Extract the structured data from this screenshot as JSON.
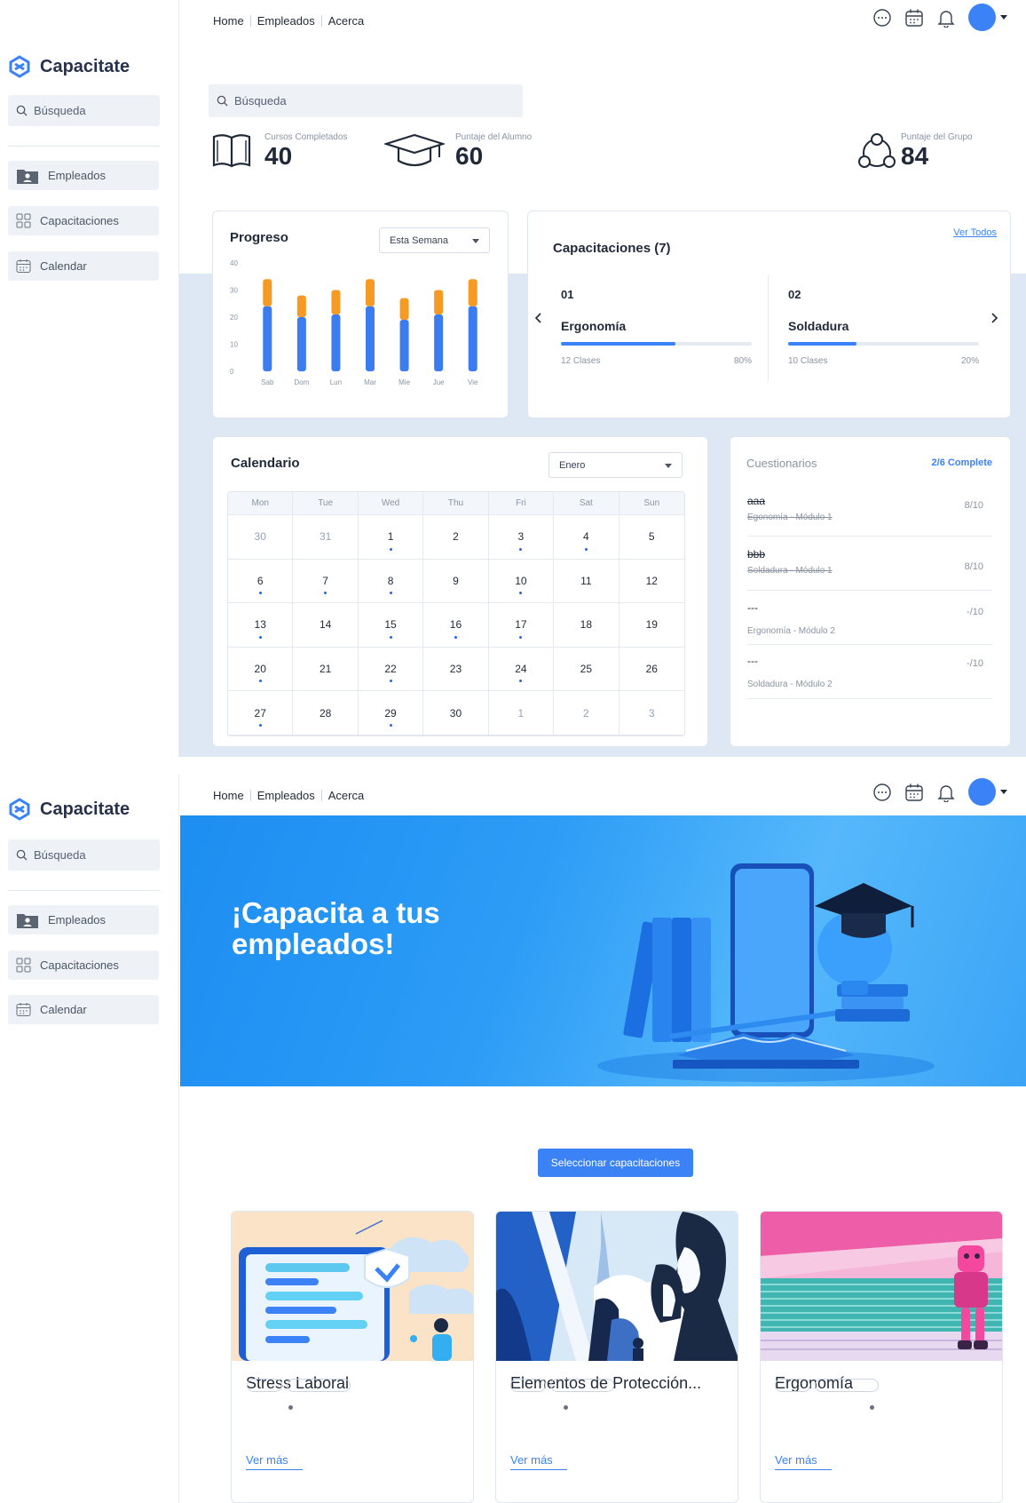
{
  "app": {
    "name": "Capacitate"
  },
  "topnav": {
    "items": [
      "Home",
      "Empleados",
      "Acerca"
    ]
  },
  "sidebar": {
    "search_placeholder": "Búsqueda",
    "items": [
      {
        "label": "Empleados",
        "icon": "folder-user-icon"
      },
      {
        "label": "Capacitaciones",
        "icon": "grid-icon"
      },
      {
        "label": "Calendar",
        "icon": "calendar-icon"
      }
    ]
  },
  "dashboard": {
    "search_placeholder": "Búsqueda",
    "stats": [
      {
        "label": "Cursos Completados",
        "value": "40",
        "icon": "book-icon"
      },
      {
        "label": "Puntaje del Alumno",
        "value": "60",
        "icon": "graduation-cap-icon"
      },
      {
        "label": "Puntaje del Grupo",
        "value": "84",
        "icon": "group-icon"
      }
    ],
    "progress": {
      "title": "Progreso",
      "select": "Esta Semana"
    },
    "trainings": {
      "title": "Capacitaciones (7)",
      "view_all": "Ver Todos",
      "items": [
        {
          "num": "01",
          "name": "Ergonomía",
          "classes": "12 Clases",
          "percent": "80%",
          "progress": 0.6
        },
        {
          "num": "02",
          "name": "Soldadura",
          "classes": "10 Clases",
          "percent": "20%",
          "progress": 0.36
        }
      ]
    },
    "calendar": {
      "title": "Calendario",
      "select": "Enero",
      "weekdays": [
        "Mon",
        "Tue",
        "Wed",
        "Thu",
        "Fri",
        "Sat",
        "Sun"
      ],
      "weeks": [
        [
          {
            "d": "30",
            "m": true
          },
          {
            "d": "31",
            "m": true
          },
          {
            "d": "1",
            "dot": true
          },
          {
            "d": "2"
          },
          {
            "d": "3",
            "dot": true
          },
          {
            "d": "4",
            "dot": true
          },
          {
            "d": "5"
          }
        ],
        [
          {
            "d": "6",
            "dot": true
          },
          {
            "d": "7",
            "dot": true
          },
          {
            "d": "8",
            "dot": true
          },
          {
            "d": "9"
          },
          {
            "d": "10",
            "dot": true
          },
          {
            "d": "11"
          },
          {
            "d": "12"
          }
        ],
        [
          {
            "d": "13",
            "dot": true
          },
          {
            "d": "14"
          },
          {
            "d": "15",
            "dot": true
          },
          {
            "d": "16",
            "dot": true
          },
          {
            "d": "17",
            "dot": true
          },
          {
            "d": "18"
          },
          {
            "d": "19"
          }
        ],
        [
          {
            "d": "20",
            "dot": true
          },
          {
            "d": "21"
          },
          {
            "d": "22",
            "dot": true
          },
          {
            "d": "23"
          },
          {
            "d": "24",
            "dot": true
          },
          {
            "d": "25"
          },
          {
            "d": "26"
          }
        ],
        [
          {
            "d": "27",
            "dot": true
          },
          {
            "d": "28"
          },
          {
            "d": "29",
            "dot": true
          },
          {
            "d": "30"
          },
          {
            "d": "1",
            "m": true
          },
          {
            "d": "2",
            "m": true
          },
          {
            "d": "3",
            "m": true
          }
        ]
      ]
    },
    "quizzes": {
      "title": "Cuestionarios",
      "status": "2/6 Complete",
      "items": [
        {
          "title": "aaa",
          "subtitle": "Egonomía - Módulo 1",
          "score": "8/10",
          "done": true
        },
        {
          "title": "bbb",
          "subtitle": "Soldadura - Módulo 1",
          "score": "8/10",
          "done": true
        },
        {
          "title": "---",
          "subtitle": "Ergonomía - Módulo 2",
          "score": "-/10",
          "done": false
        },
        {
          "title": "---",
          "subtitle": "Soldadura - Módulo 2",
          "score": "-/10",
          "done": false
        }
      ]
    }
  },
  "chart_data": {
    "type": "bar",
    "title": "Progreso",
    "categories": [
      "Sab",
      "Dom",
      "Lun",
      "Mar",
      "Mie",
      "Jue",
      "Vie"
    ],
    "series": [
      {
        "values": [
          24,
          20,
          21,
          24,
          19,
          21,
          24
        ]
      },
      {
        "values": [
          10,
          8,
          9,
          10,
          8,
          9,
          10
        ]
      }
    ],
    "stacked": true,
    "ylim": [
      0,
      40
    ],
    "yticks": [
      0,
      10,
      20,
      30,
      40
    ],
    "colors": [
      "#3b7cf0",
      "#f59a23"
    ],
    "grid": false
  },
  "hero": {
    "title": "¡Capacita a tus empleados!",
    "button": "Seleccionar capacitaciones"
  },
  "courses": [
    {
      "title": "Stress Laboral",
      "more": "Ver más"
    },
    {
      "title": "Elementos de Protección...",
      "more": "Ver más"
    },
    {
      "title": "Ergonomía",
      "more": "Ver más"
    }
  ],
  "colors": {
    "accent": "#3b82f6",
    "band": "#dde8f4",
    "orange": "#f59a23"
  }
}
